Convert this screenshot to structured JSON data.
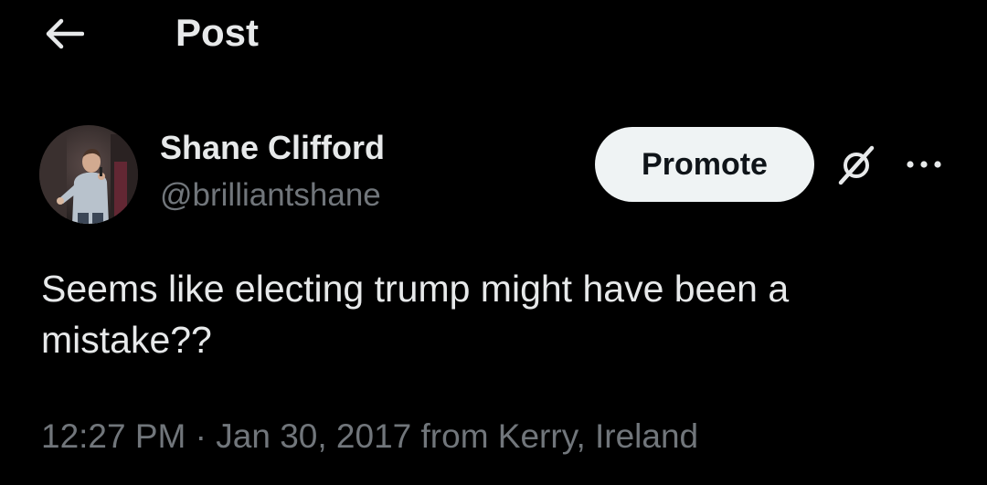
{
  "header": {
    "title": "Post",
    "back_icon": "arrow-left-icon"
  },
  "author": {
    "display_name": "Shane Clifford",
    "handle": "@brilliantshane"
  },
  "actions": {
    "promote_label": "Promote",
    "grok_icon": "grok-icon",
    "more_icon": "more-horizontal-icon"
  },
  "post": {
    "text": "Seems like electing trump might have been a mistake??",
    "time": "12:27 PM",
    "separator": " · ",
    "date": "Jan 30, 2017",
    "location": " from Kerry, Ireland"
  },
  "colors": {
    "background": "#000000",
    "primary_text": "#e7e9ea",
    "secondary_text": "#71767b",
    "promote_bg": "#eff3f4",
    "promote_text": "#0f1419"
  }
}
